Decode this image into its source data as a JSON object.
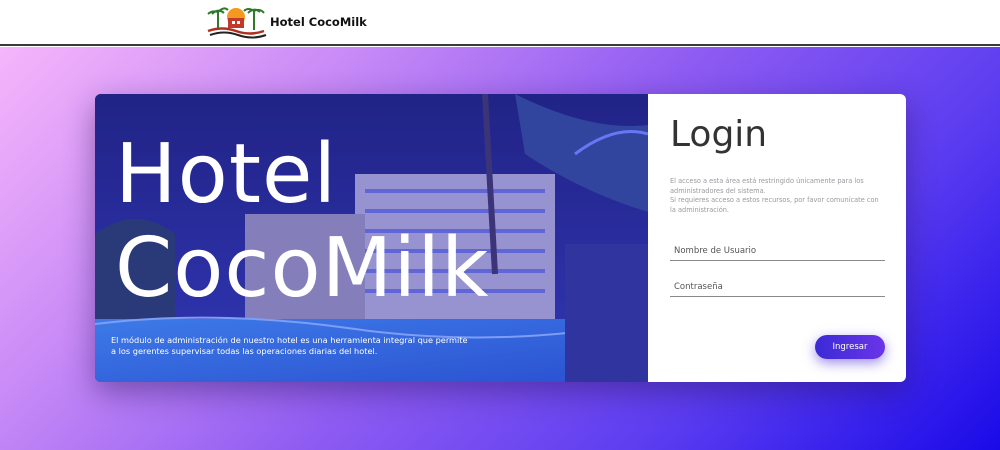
{
  "header": {
    "brand_name": "Hotel CocoMilk",
    "logo_icon": "hotel-palm-logo-icon"
  },
  "hero": {
    "title_line1": "Hotel",
    "title_line2": "CocoMilk",
    "description": "El módulo de administración de nuestro hotel es una herramienta integral que permite a los gerentes supervisar todas las operaciones diarias del hotel."
  },
  "login": {
    "title": "Login",
    "note_line1": "El acceso a esta área está restringido únicamente para los administradores del sistema.",
    "note_line2": "Si requieres acceso a estos recursos, por favor comunícate con la administración.",
    "username_placeholder": "Nombre de Usuario",
    "password_placeholder": "Contraseña",
    "submit_label": "Ingresar"
  },
  "colors": {
    "gradient_start": "#f6b6fb",
    "gradient_end": "#1a0ae8",
    "button": "#4b2fdd",
    "overlay": "#3c3ce6"
  }
}
